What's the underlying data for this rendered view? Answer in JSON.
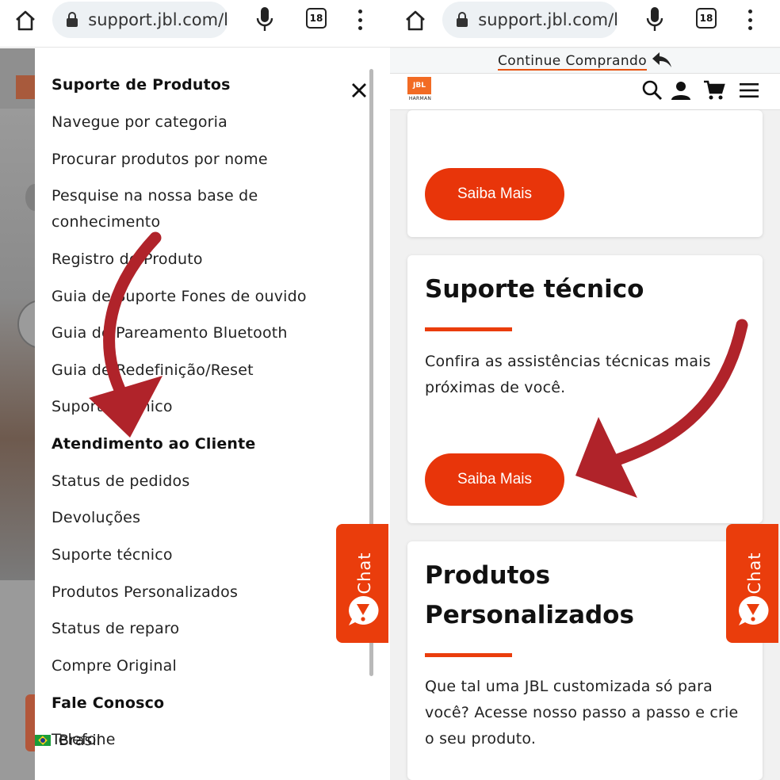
{
  "browser": {
    "url": "support.jbl.com/l",
    "tab_count": "18"
  },
  "left_panel": {
    "drawer": {
      "items": [
        {
          "label": "Suporte de Produtos",
          "heading": true
        },
        {
          "label": "Navegue por categoria"
        },
        {
          "label": "Procurar produtos por nome"
        },
        {
          "label": "Pesquise na nossa base de conhecimento"
        },
        {
          "label": "Registro de Produto"
        },
        {
          "label": "Guia de Suporte Fones de ouvido"
        },
        {
          "label": "Guia de Pareamento Bluetooth"
        },
        {
          "label": "Guia de Redefinição/Reset"
        },
        {
          "label": "Suporte técnico"
        },
        {
          "label": "Atendimento ao Cliente",
          "heading": true
        },
        {
          "label": "Status de pedidos"
        },
        {
          "label": "Devoluções"
        },
        {
          "label": "Suporte técnico"
        },
        {
          "label": "Produtos Personalizados"
        },
        {
          "label": "Status de reparo"
        },
        {
          "label": "Compre Original"
        },
        {
          "label": "Fale Conosco",
          "heading": true
        },
        {
          "label": "Telefone"
        }
      ],
      "country": "Brasil"
    },
    "chat_label": "Chat"
  },
  "right_panel": {
    "continue_link": "Continue Comprando",
    "cards": [
      {
        "button": "Saiba Mais"
      },
      {
        "title": "Suporte técnico",
        "text": "Confira as assistências técnicas mais próximas de você.",
        "button": "Saiba Mais"
      },
      {
        "title": "Produtos Personalizados",
        "text": "Que tal uma JBL customizada só para você? Acesse nosso passo a passo e crie o seu produto."
      }
    ],
    "chat_label": "Chat"
  },
  "logo": {
    "brand": "JBL",
    "sub": "HARMAN"
  },
  "colors": {
    "accent": "#ea3d0c",
    "arrow": "#b0232a",
    "url_pill": "#edf1f4"
  }
}
